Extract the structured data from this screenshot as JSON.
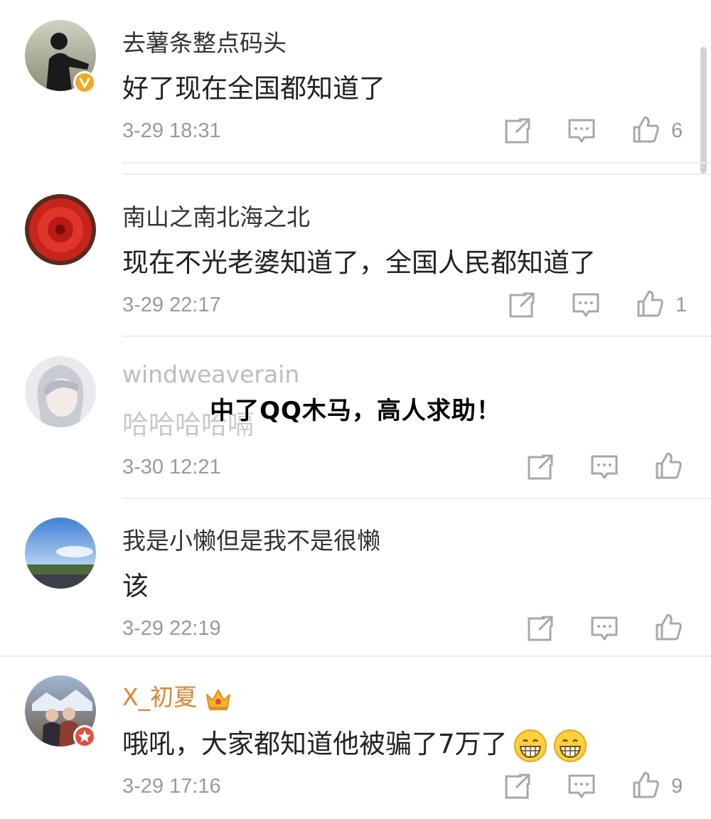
{
  "overlay": {
    "title": "中了QQ木马，高人求助！"
  },
  "comments": [
    {
      "user": "去薯条整点码头",
      "text": "好了现在全国都知道了",
      "time": "3-29 18:31",
      "likes": "6",
      "badge": "verified-v-badge",
      "avatar": "silhouette-avatar"
    },
    {
      "user": "南山之南北海之北",
      "text": "现在不光老婆知道了，全国人民都知道了",
      "time": "3-29 22:17",
      "likes": "1",
      "avatar": "red-flower-avatar"
    },
    {
      "user": "windweaverain",
      "text": "哈哈哈哈嗝",
      "time": "3-30 12:21",
      "likes": "",
      "avatar": "anime-portrait-avatar"
    },
    {
      "user": "我是小懒但是我不是很懒",
      "text": "该",
      "time": "3-29 22:19",
      "likes": "",
      "avatar": "sky-landscape-avatar"
    },
    {
      "user": "X_初夏",
      "text": "哦吼，大家都知道他被骗了7万了",
      "time": "3-29 17:16",
      "likes": "9",
      "badge": "vip-star-badge",
      "avatar": "couple-photo-avatar",
      "emoji_count": 2
    }
  ],
  "colors": {
    "username": "#333333",
    "vip_username": "#e8832d",
    "timestamp": "#9a9a9a",
    "icon": "#a8a8a8",
    "divider": "#ededed",
    "verified_badge": "#f5a623",
    "vip_badge": "#e84a3a"
  }
}
